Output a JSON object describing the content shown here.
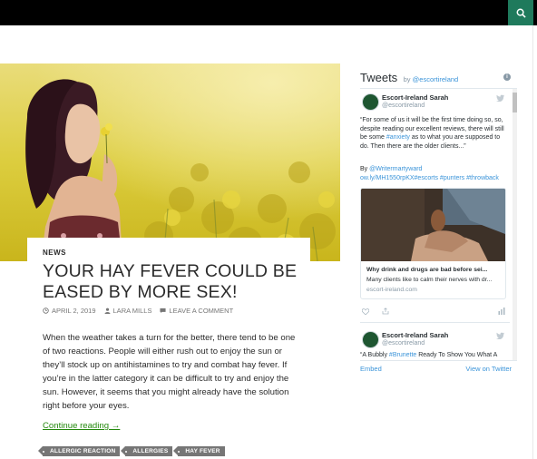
{
  "icons": {
    "search": "search-icon",
    "info": "info-icon",
    "bird": "twitter-bird-icon",
    "calendar": "calendar-icon",
    "user": "user-icon",
    "comment": "comment-icon",
    "heart": "heart-icon",
    "share": "share-icon"
  },
  "colors": {
    "accent": "#24890d",
    "search_bg": "#1f7a5c",
    "twitter_link": "#3b94d9",
    "tag_bg": "#767676"
  },
  "post": {
    "category": "NEWS",
    "title": "YOUR HAY FEVER COULD BE EASED BY MORE SEX!",
    "date": "APRIL 2, 2019",
    "author": "LARA MILLS",
    "comment_link": "LEAVE A COMMENT",
    "excerpt": "When the weather takes a turn for the better, there tend to be one of two reactions. People will either rush out to enjoy the sun or they’ll stock up on antihistamines to try and combat hay fever. If you’re in the latter category it can be difficult to try and enjoy the sun. However, it seems that you might already have the solution right before your eyes.",
    "continue": "Continue reading →",
    "tags": [
      "ALLERGIC REACTION",
      "ALLERGIES",
      "HAY FEVER"
    ]
  },
  "twitter": {
    "title": "Tweets",
    "by": "by",
    "handle_link": "@escortireland",
    "tweets": [
      {
        "name": "Escort-Ireland Sarah",
        "handle": "@escortireland",
        "text_before": "“For some of us it will be the first time doing so, so, despite reading our excellent reviews, there will still be some",
        "text_link": "#anxiety",
        "text_after": "as to what you are supposed to do. Then there are the older clients...”",
        "by_line_prefix": "By",
        "by_line_link": "@Writermartyward",
        "link_line": "ow.ly/MH1550rpKX",
        "hashtags": "#escorts #punters #throwback",
        "card_title": "Why drink and drugs are bad before sei...",
        "card_desc": "Many clients like to calm their nerves with dr...",
        "card_domain": "escort-ireland.com"
      },
      {
        "name": "Escort-Ireland Sarah",
        "handle": "@escortireland",
        "text_partial_before": "“A Bubbly",
        "text_partial_link": "#Brunette",
        "text_partial_after": "Ready To Show You What A"
      }
    ],
    "embed": "Embed",
    "view_on": "View on Twitter"
  }
}
